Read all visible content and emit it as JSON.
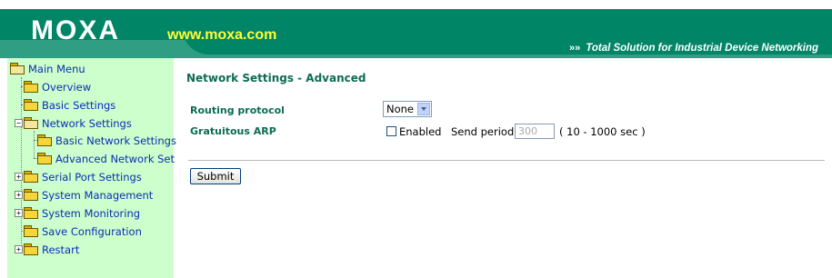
{
  "header": {
    "logo": "MOXA",
    "site": "www.moxa.com",
    "tagline": "Total Solution for Industrial Device Networking"
  },
  "sidebar": {
    "items": [
      {
        "label": "Main Menu"
      },
      {
        "label": "Overview"
      },
      {
        "label": "Basic Settings"
      },
      {
        "label": "Network Settings"
      },
      {
        "label": "Basic Network Settings"
      },
      {
        "label": "Advanced Network Set"
      },
      {
        "label": "Serial Port Settings"
      },
      {
        "label": "System Management"
      },
      {
        "label": "System Monitoring"
      },
      {
        "label": "Save Configuration"
      },
      {
        "label": "Restart"
      }
    ]
  },
  "main": {
    "title": "Network Settings - Advanced",
    "routing": {
      "label": "Routing protocol",
      "value": "None"
    },
    "arp": {
      "label": "Gratuitous ARP",
      "enabled_label": "Enabled",
      "enabled": false,
      "send_period_label": "Send period",
      "send_period_value": "300",
      "range": "( 10 - 1000 sec )"
    },
    "submit_label": "Submit"
  },
  "colors": {
    "header_green": "#008567",
    "sidebar_bg": "#ccffcc",
    "link_blue": "#0a2eb5",
    "label_green": "#0d6b55",
    "site_yellow": "#ffff33"
  }
}
